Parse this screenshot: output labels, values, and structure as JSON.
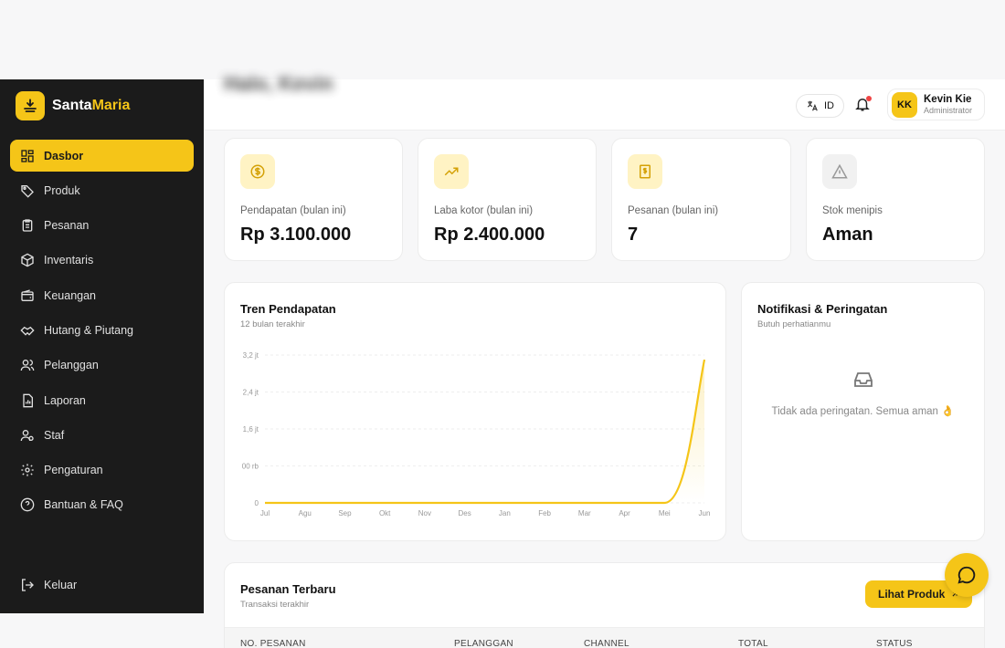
{
  "brand": {
    "name_part1": "Santa",
    "name_part2": "Maria"
  },
  "header": {
    "title": "Halo, Kevin",
    "language": "ID",
    "user": {
      "initials": "KK",
      "name": "Kevin Kie",
      "role": "Administrator"
    }
  },
  "sidebar": {
    "items": [
      {
        "label": "Dasbor",
        "icon": "dashboard-icon"
      },
      {
        "label": "Produk",
        "icon": "tag-icon"
      },
      {
        "label": "Pesanan",
        "icon": "clipboard-icon"
      },
      {
        "label": "Inventaris",
        "icon": "box-icon"
      },
      {
        "label": "Keuangan",
        "icon": "wallet-icon"
      },
      {
        "label": "Hutang & Piutang",
        "icon": "handshake-icon"
      },
      {
        "label": "Pelanggan",
        "icon": "users-icon"
      },
      {
        "label": "Laporan",
        "icon": "report-icon"
      },
      {
        "label": "Staf",
        "icon": "staff-icon"
      },
      {
        "label": "Pengaturan",
        "icon": "gear-icon"
      },
      {
        "label": "Bantuan & FAQ",
        "icon": "help-icon"
      }
    ],
    "logout": "Keluar"
  },
  "stats": [
    {
      "label": "Pendapatan (bulan ini)",
      "value": "Rp 3.100.000",
      "icon": "dollar-coin-icon"
    },
    {
      "label": "Laba kotor (bulan ini)",
      "value": "Rp 2.400.000",
      "icon": "trending-up-icon"
    },
    {
      "label": "Pesanan (bulan ini)",
      "value": "7",
      "icon": "receipt-icon"
    },
    {
      "label": "Stok menipis",
      "value": "Aman",
      "icon": "warning-icon"
    }
  ],
  "revenue": {
    "title": "Tren Pendapatan",
    "subtitle": "12 bulan terakhir"
  },
  "chart_data": {
    "type": "area",
    "title": "Tren Pendapatan",
    "x": [
      "Jul",
      "Agu",
      "Sep",
      "Okt",
      "Nov",
      "Des",
      "Jan",
      "Feb",
      "Mar",
      "Apr",
      "Mei",
      "Jun"
    ],
    "values": [
      0,
      0,
      0,
      0,
      0,
      0,
      0,
      0,
      0,
      0,
      0,
      3100000
    ],
    "y_ticks": [
      "0",
      "00 rb",
      "1,6 jt",
      "2,4 jt",
      "3,2 jt"
    ],
    "y_tick_values": [
      0,
      800000,
      1600000,
      2400000,
      3200000
    ],
    "ylim": [
      0,
      3200000
    ],
    "grid": true,
    "color": "#f5c518"
  },
  "notifications": {
    "title": "Notifikasi & Peringatan",
    "subtitle": "Butuh perhatianmu",
    "empty_text": "Tidak ada peringatan. Semua aman 👌"
  },
  "orders": {
    "title": "Pesanan Terbaru",
    "subtitle": "Transaksi terakhir",
    "button": "Lihat Produk",
    "columns": [
      "NO. PESANAN",
      "PELANGGAN",
      "CHANNEL",
      "TOTAL",
      "STATUS"
    ]
  },
  "colors": {
    "accent": "#f5c518",
    "sidebar": "#1b1b1b"
  }
}
